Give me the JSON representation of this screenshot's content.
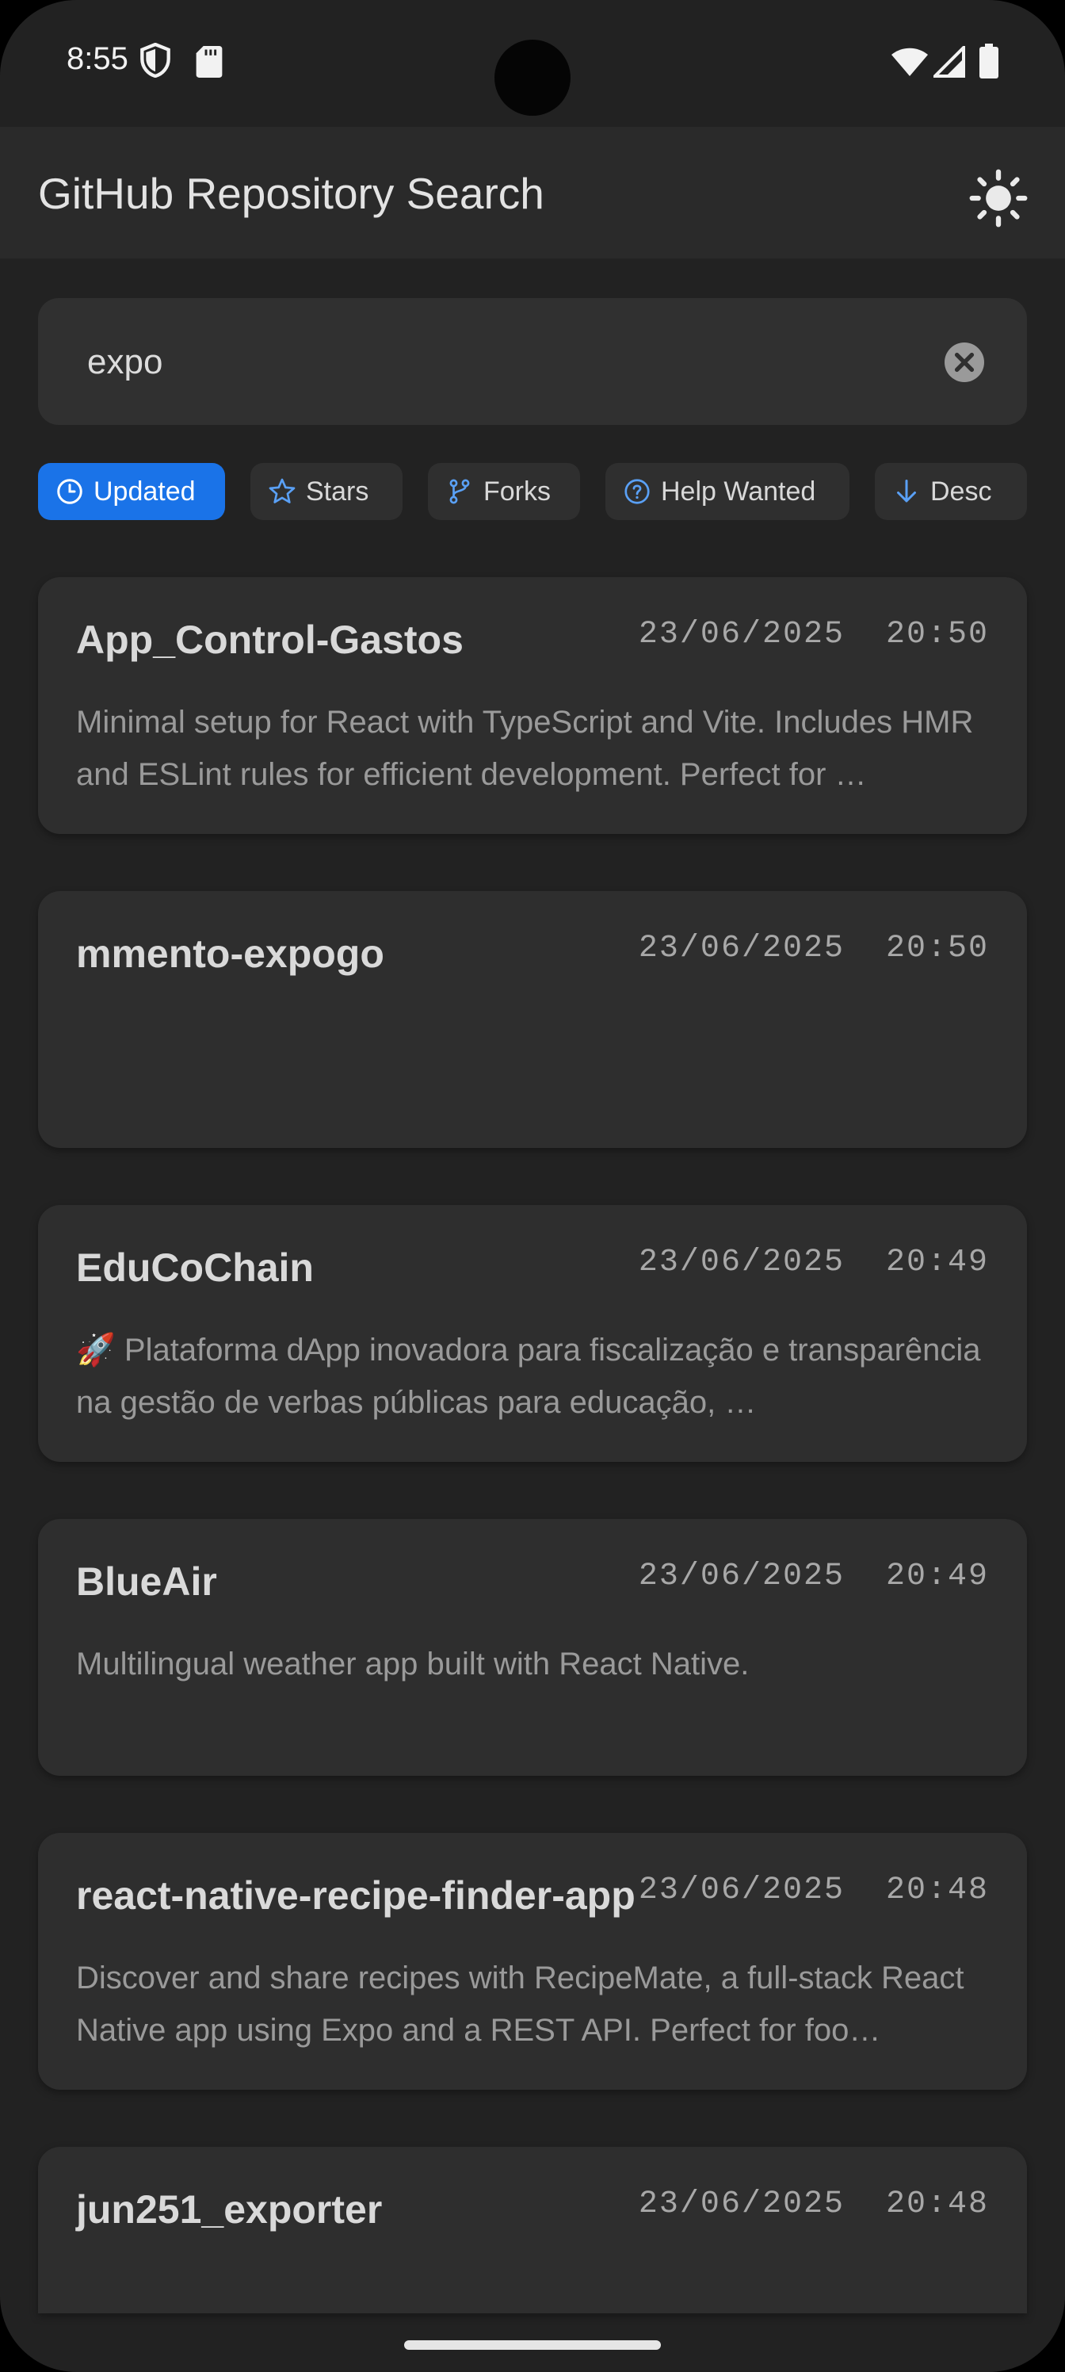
{
  "status_bar": {
    "time": "8:55",
    "icons": [
      "shield-icon",
      "sd-card-icon",
      "wifi-icon",
      "cell-signal-icon",
      "battery-icon"
    ]
  },
  "app_bar": {
    "title": "GitHub Repository Search",
    "theme_icon": "sun-icon"
  },
  "search": {
    "value": "expo",
    "clear_icon": "clear-icon"
  },
  "filters": [
    {
      "label": "Updated",
      "icon": "clock-icon",
      "active": true
    },
    {
      "label": "Stars",
      "icon": "star-icon",
      "active": false
    },
    {
      "label": "Forks",
      "icon": "fork-icon",
      "active": false
    },
    {
      "label": "Help Wanted",
      "icon": "help-icon",
      "active": false
    },
    {
      "label": "Desc",
      "icon": "arrow-down-icon",
      "active": false
    }
  ],
  "repositories": [
    {
      "name": "App_Control-Gastos",
      "updated": "23/06/2025  20:50",
      "description": "Minimal setup for React with TypeScript and Vite. Includes HMR and ESLint rules for efficient development. Perfect for …"
    },
    {
      "name": "mmento-expogo",
      "updated": "23/06/2025  20:50",
      "description": ""
    },
    {
      "name": "EduCoChain",
      "updated": "23/06/2025  20:49",
      "description": "🚀 Plataforma dApp inovadora para fiscalização e transparência na gestão de verbas públicas para educação, …"
    },
    {
      "name": "BlueAir",
      "updated": "23/06/2025  20:49",
      "description": "Multilingual weather app built with React Native."
    },
    {
      "name": "react-native-recipe-finder-app",
      "updated": "23/06/2025  20:48",
      "description": "Discover and share recipes with RecipeMate, a full-stack React Native app using Expo and a REST API. Perfect for foo…"
    },
    {
      "name": "jun251_exporter",
      "updated": "23/06/2025  20:48",
      "description": ""
    }
  ],
  "colors": {
    "background": "#222222",
    "card": "#2e2e2e",
    "accent": "#1a73e8",
    "chip_icon": "#5aa0f5"
  }
}
